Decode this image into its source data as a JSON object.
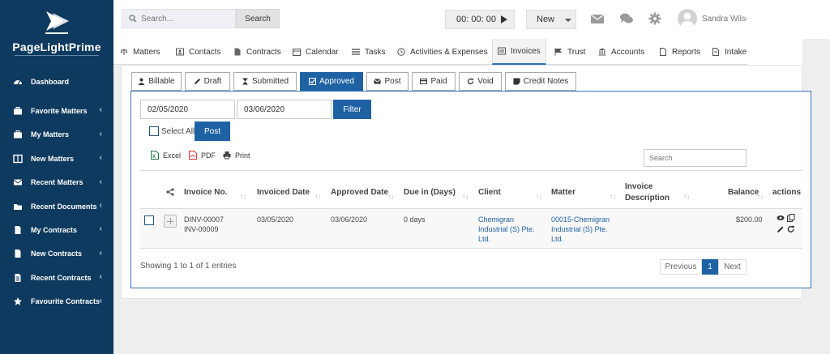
{
  "app": {
    "logo_text": "PageLightPrime"
  },
  "sidebar": {
    "items": [
      {
        "label": "Dashboard",
        "icon": "dashboard-icon",
        "chevron": false
      },
      {
        "label": "Favorite Matters",
        "icon": "briefcase-icon",
        "chevron": true
      },
      {
        "label": "My Matters",
        "icon": "briefcase-icon",
        "chevron": true
      },
      {
        "label": "New Matters",
        "icon": "columns-icon",
        "chevron": true
      },
      {
        "label": "Recent Matters",
        "icon": "envelope-icon",
        "chevron": true
      },
      {
        "label": "Recent Documents",
        "icon": "folder-icon",
        "chevron": true
      },
      {
        "label": "My Contracts",
        "icon": "document-icon",
        "chevron": true
      },
      {
        "label": "New Contracts",
        "icon": "document-icon",
        "chevron": true
      },
      {
        "label": "Recent Contracts",
        "icon": "list-document-icon",
        "chevron": true
      },
      {
        "label": "Favourite Contracts",
        "icon": "star-icon",
        "chevron": true
      }
    ],
    "chevron_glyph": "‹"
  },
  "topbar": {
    "search_placeholder": "Search...",
    "search_button": "Search",
    "timer": "00: 00: 00",
    "new_button": "New",
    "user_name": "Sandra Wilson"
  },
  "main_tabs": [
    {
      "label": "Matters",
      "icon": "scales-icon"
    },
    {
      "label": "Contacts",
      "icon": "contact-card-icon"
    },
    {
      "label": "Contracts",
      "icon": "file-icon"
    },
    {
      "label": "Calendar",
      "icon": "calendar-icon"
    },
    {
      "label": "Tasks",
      "icon": "tasks-icon"
    },
    {
      "label": "Activities & Expenses",
      "icon": "clock-icon"
    },
    {
      "label": "Invoices",
      "icon": "invoice-icon"
    },
    {
      "label": "Trust",
      "icon": "flag-icon"
    },
    {
      "label": "Accounts",
      "icon": "bank-icon"
    },
    {
      "label": "Reports",
      "icon": "report-icon"
    },
    {
      "label": "Intake",
      "icon": "intake-icon"
    }
  ],
  "sub_tabs": [
    {
      "label": "Billable",
      "icon": "user-icon"
    },
    {
      "label": "Draft",
      "icon": "pencil-icon"
    },
    {
      "label": "Submitted",
      "icon": "hourglass-icon"
    },
    {
      "label": "Approved",
      "icon": "check-square-icon"
    },
    {
      "label": "Post",
      "icon": "envelope-icon"
    },
    {
      "label": "Paid",
      "icon": "credit-card-icon"
    },
    {
      "label": "Void",
      "icon": "refresh-icon"
    },
    {
      "label": "Credit Notes",
      "icon": "note-icon"
    }
  ],
  "filter": {
    "from_date": "02/05/2020",
    "to_date": "03/06/2020",
    "filter_button": "Filter",
    "select_all": "Select All",
    "post_button": "Post"
  },
  "export": {
    "excel": "Excel",
    "pdf": "PDF",
    "print": "Print",
    "search_placeholder": "Search"
  },
  "table": {
    "headers": {
      "invoice_no": "Invoice No.",
      "invoiced_date": "Invoiced Date",
      "approved_date": "Approved Date",
      "due": "Due in (Days)",
      "client": "Client",
      "matter": "Matter",
      "invoice_desc_1": "Invoice",
      "invoice_desc_2": "Description",
      "balance": "Balance",
      "actions": "actions"
    },
    "sort_glyph": "↑↓",
    "row": {
      "invoice_no_1": "DINV-00007",
      "invoice_no_2": "INV-00009",
      "invoiced_date": "03/05/2020",
      "approved_date": "03/06/2020",
      "due": "0 days",
      "client_1": "Chemigran",
      "client_2": "Industrial (S) Pte.",
      "client_3": "Ltd.",
      "matter_1": "00015-Chemigran",
      "matter_2": "Industrial (S) Pte.",
      "matter_3": "Ltd.",
      "balance": "$200.00"
    },
    "showing": "Showing 1 to 1 of 1 entries",
    "pager": {
      "previous": "Previous",
      "current": "1",
      "next": "Next"
    }
  }
}
